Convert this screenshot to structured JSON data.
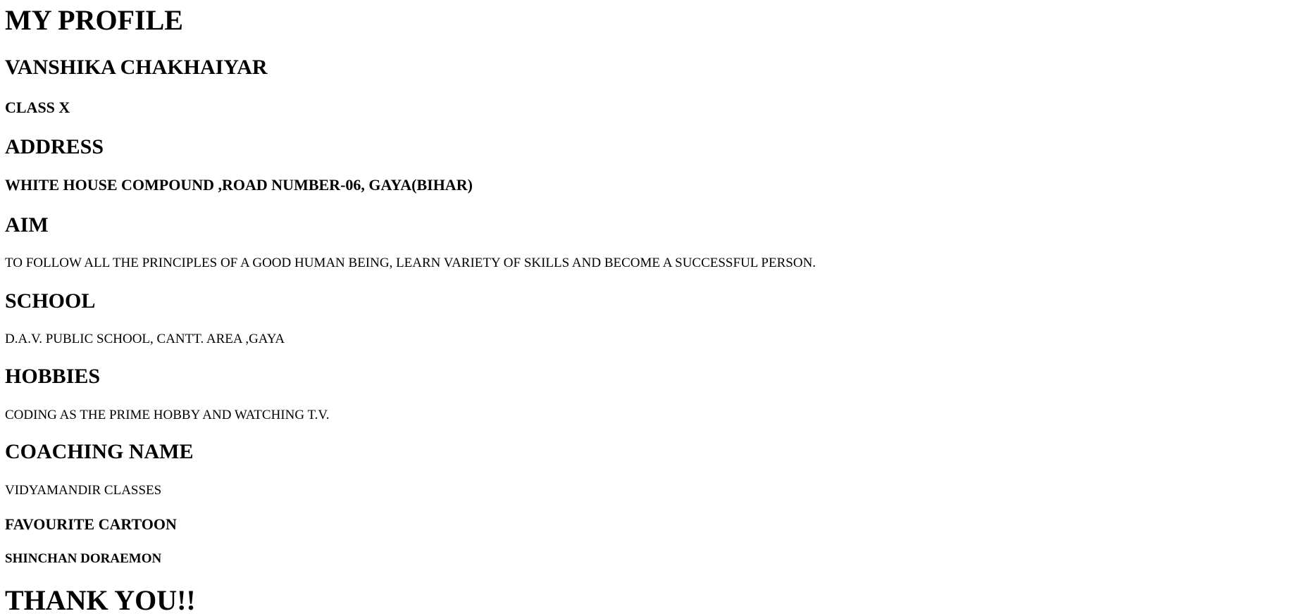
{
  "profile": {
    "title": "MY PROFILE",
    "name": "VANSHIKA CHAKHAIYAR",
    "class": "CLASS X",
    "address_heading": "ADDRESS",
    "address": "WHITE HOUSE COMPOUND ,ROAD NUMBER-06, GAYA(BIHAR)",
    "aim_heading": "AIM",
    "aim": "TO FOLLOW ALL THE PRINCIPLES OF A GOOD HUMAN BEING, LEARN VARIETY OF SKILLS AND BECOME A SUCCESSFUL PERSON.",
    "school_heading": "SCHOOL",
    "school": "D.A.V. PUBLIC SCHOOL, CANTT. AREA ,GAYA",
    "hobbies_heading": "HOBBIES",
    "hobbies": "CODING AS THE PRIME HOBBY AND WATCHING T.V.",
    "coaching_heading": "COACHING NAME",
    "coaching": "VIDYAMANDIR CLASSES",
    "cartoon_heading": "FAVOURITE CARTOON",
    "cartoon": "SHINCHAN DORAEMON",
    "closing": "THANK YOU!!"
  }
}
